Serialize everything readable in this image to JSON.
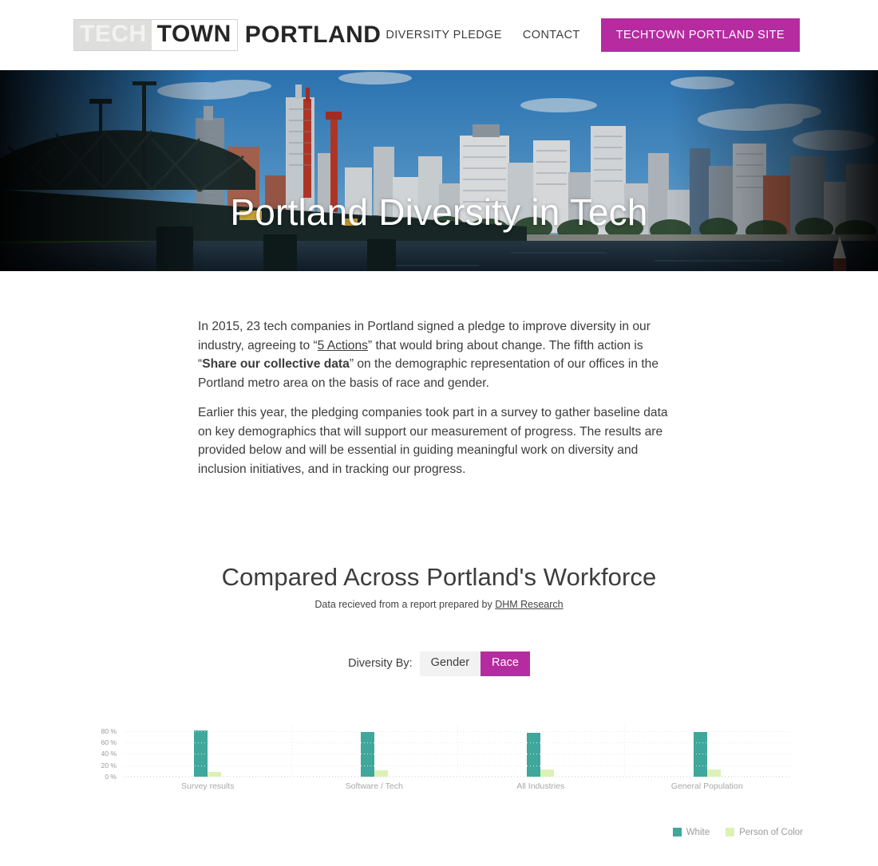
{
  "header": {
    "logo": {
      "part1": "TECH",
      "part2": "TOWN",
      "part3": "PORTLAND"
    },
    "nav": [
      {
        "label": "DIVERSITY PLEDGE",
        "name": "nav-diversity-pledge"
      },
      {
        "label": "CONTACT",
        "name": "nav-contact"
      }
    ],
    "cta": {
      "label": "TECHTOWN PORTLAND SITE",
      "color": "#b62ba0"
    }
  },
  "hero": {
    "title": "Portland Diversity in Tech"
  },
  "intro": {
    "p1_a": "In 2015, 23 tech companies in Portland signed a pledge to improve diversity in our industry, agreeing to “",
    "p1_link": "5 Actions",
    "p1_b": "” that would bring about change. The fifth action is “",
    "p1_bold": "Share our collective data",
    "p1_c": "” on the demographic representation of our offices in the Portland metro area on the basis of race and gender.",
    "p2": "Earlier this year, the pledging companies took part in a survey to gather baseline data on key demographics that will support our measurement of progress. The results are provided below and will be essential in guiding meaningful work on diversity and inclusion initiatives, and in tracking our progress."
  },
  "chart_section": {
    "title": "Compared Across Portland's Workforce",
    "subtitle_prefix": "Data recieved from a report prepared by ",
    "subtitle_link": "DHM Research",
    "toggle_label": "Diversity By:",
    "toggles": [
      {
        "label": "Gender",
        "active": false
      },
      {
        "label": "Race",
        "active": true
      }
    ]
  },
  "chart_data": {
    "type": "bar",
    "title": "Compared Across Portland's Workforce",
    "subtitle": "Data recieved from a report prepared by DHM Research",
    "categories": [
      "Survey results",
      "Software / Tech",
      "All Industries",
      "General Population"
    ],
    "series": [
      {
        "name": "White",
        "color": "#3fa79b",
        "values": [
          82,
          79,
          77,
          78
        ]
      },
      {
        "name": "Person of Color",
        "color": "#dcf2b4",
        "values": [
          9,
          11,
          13,
          12
        ]
      }
    ],
    "xlabel": "",
    "ylabel": "",
    "ylim": [
      0,
      90
    ],
    "y_ticks": [
      "0 %",
      "20 %",
      "40 %",
      "60 %",
      "80 %"
    ],
    "y_tick_values": [
      0,
      20,
      40,
      60,
      80
    ],
    "grid": true,
    "legend_position": "bottom-right"
  }
}
